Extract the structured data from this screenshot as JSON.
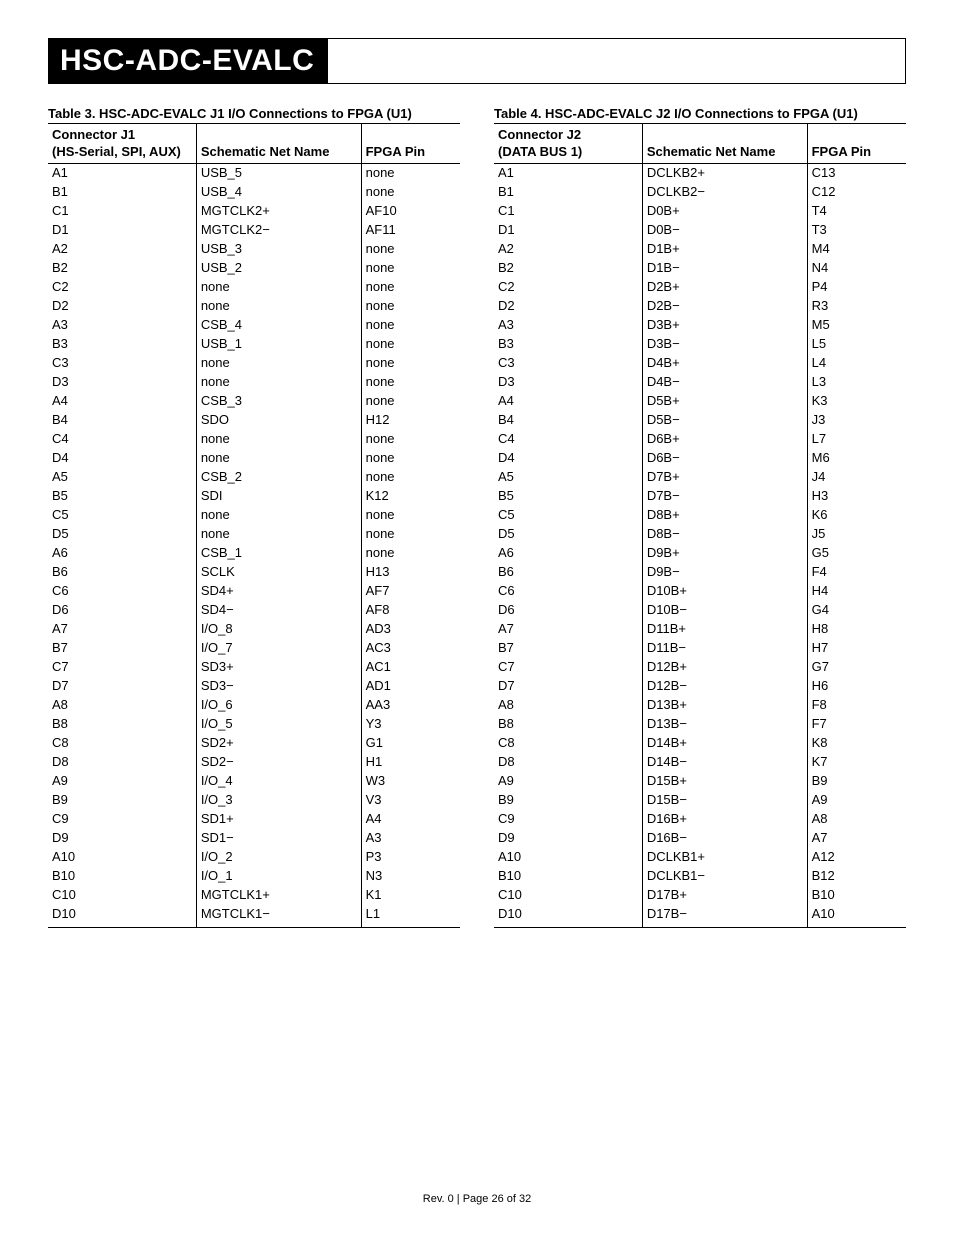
{
  "page_title": "HSC-ADC-EVALC",
  "footer": "Rev. 0 | Page 26 of 32",
  "table3": {
    "caption": "Table 3. HSC-ADC-EVALC J1 I/O Connections to FPGA (U1)",
    "head": {
      "c1a": "Connector J1",
      "c1b": "(HS-Serial, SPI, AUX)",
      "c2": "Schematic Net Name",
      "c3": "FPGA Pin"
    },
    "rows": [
      [
        "A1",
        "USB_5",
        "none"
      ],
      [
        "B1",
        "USB_4",
        "none"
      ],
      [
        "C1",
        "MGTCLK2+",
        "AF10"
      ],
      [
        "D1",
        "MGTCLK2−",
        "AF11"
      ],
      [
        "A2",
        "USB_3",
        "none"
      ],
      [
        "B2",
        "USB_2",
        "none"
      ],
      [
        "C2",
        "none",
        "none"
      ],
      [
        "D2",
        "none",
        "none"
      ],
      [
        "A3",
        "CSB_4",
        "none"
      ],
      [
        "B3",
        "USB_1",
        "none"
      ],
      [
        "C3",
        "none",
        "none"
      ],
      [
        "D3",
        "none",
        "none"
      ],
      [
        "A4",
        "CSB_3",
        "none"
      ],
      [
        "B4",
        "SDO",
        "H12"
      ],
      [
        "C4",
        "none",
        "none"
      ],
      [
        "D4",
        "none",
        "none"
      ],
      [
        "A5",
        "CSB_2",
        "none"
      ],
      [
        "B5",
        "SDI",
        "K12"
      ],
      [
        "C5",
        "none",
        "none"
      ],
      [
        "D5",
        "none",
        "none"
      ],
      [
        "A6",
        "CSB_1",
        "none"
      ],
      [
        "B6",
        "SCLK",
        "H13"
      ],
      [
        "C6",
        "SD4+",
        "AF7"
      ],
      [
        "D6",
        "SD4−",
        "AF8"
      ],
      [
        "A7",
        "I/O_8",
        "AD3"
      ],
      [
        "B7",
        "I/O_7",
        "AC3"
      ],
      [
        "C7",
        "SD3+",
        "AC1"
      ],
      [
        "D7",
        "SD3−",
        "AD1"
      ],
      [
        "A8",
        "I/O_6",
        "AA3"
      ],
      [
        "B8",
        "I/O_5",
        "Y3"
      ],
      [
        "C8",
        "SD2+",
        "G1"
      ],
      [
        "D8",
        "SD2−",
        "H1"
      ],
      [
        "A9",
        "I/O_4",
        "W3"
      ],
      [
        "B9",
        "I/O_3",
        "V3"
      ],
      [
        "C9",
        "SD1+",
        "A4"
      ],
      [
        "D9",
        "SD1−",
        "A3"
      ],
      [
        "A10",
        "I/O_2",
        "P3"
      ],
      [
        "B10",
        "I/O_1",
        "N3"
      ],
      [
        "C10",
        "MGTCLK1+",
        "K1"
      ],
      [
        "D10",
        "MGTCLK1−",
        "L1"
      ]
    ]
  },
  "table4": {
    "caption": "Table 4. HSC-ADC-EVALC J2 I/O Connections to FPGA (U1)",
    "head": {
      "c1a": "Connector J2",
      "c1b": "(DATA BUS 1)",
      "c2": "Schematic Net Name",
      "c3": "FPGA Pin"
    },
    "rows": [
      [
        "A1",
        "DCLKB2+",
        "C13"
      ],
      [
        "B1",
        "DCLKB2−",
        "C12"
      ],
      [
        "C1",
        "D0B+",
        "T4"
      ],
      [
        "D1",
        "D0B−",
        "T3"
      ],
      [
        "A2",
        "D1B+",
        "M4"
      ],
      [
        "B2",
        "D1B−",
        "N4"
      ],
      [
        "C2",
        "D2B+",
        "P4"
      ],
      [
        "D2",
        "D2B−",
        "R3"
      ],
      [
        "A3",
        "D3B+",
        "M5"
      ],
      [
        "B3",
        "D3B−",
        "L5"
      ],
      [
        "C3",
        "D4B+",
        "L4"
      ],
      [
        "D3",
        "D4B−",
        "L3"
      ],
      [
        "A4",
        "D5B+",
        "K3"
      ],
      [
        "B4",
        "D5B−",
        "J3"
      ],
      [
        "C4",
        "D6B+",
        "L7"
      ],
      [
        "D4",
        "D6B−",
        "M6"
      ],
      [
        "A5",
        "D7B+",
        "J4"
      ],
      [
        "B5",
        "D7B−",
        "H3"
      ],
      [
        "C5",
        "D8B+",
        "K6"
      ],
      [
        "D5",
        "D8B−",
        "J5"
      ],
      [
        "A6",
        "D9B+",
        "G5"
      ],
      [
        "B6",
        "D9B−",
        "F4"
      ],
      [
        "C6",
        "D10B+",
        "H4"
      ],
      [
        "D6",
        "D10B−",
        "G4"
      ],
      [
        "A7",
        "D11B+",
        "H8"
      ],
      [
        "B7",
        "D11B−",
        "H7"
      ],
      [
        "C7",
        "D12B+",
        "G7"
      ],
      [
        "D7",
        "D12B−",
        "H6"
      ],
      [
        "A8",
        "D13B+",
        "F8"
      ],
      [
        "B8",
        "D13B−",
        "F7"
      ],
      [
        "C8",
        "D14B+",
        "K8"
      ],
      [
        "D8",
        "D14B−",
        "K7"
      ],
      [
        "A9",
        "D15B+",
        "B9"
      ],
      [
        "B9",
        "D15B−",
        "A9"
      ],
      [
        "C9",
        "D16B+",
        "A8"
      ],
      [
        "D9",
        "D16B−",
        "A7"
      ],
      [
        "A10",
        "DCLKB1+",
        "A12"
      ],
      [
        "B10",
        "DCLKB1−",
        "B12"
      ],
      [
        "C10",
        "D17B+",
        "B10"
      ],
      [
        "D10",
        "D17B−",
        "A10"
      ]
    ]
  }
}
